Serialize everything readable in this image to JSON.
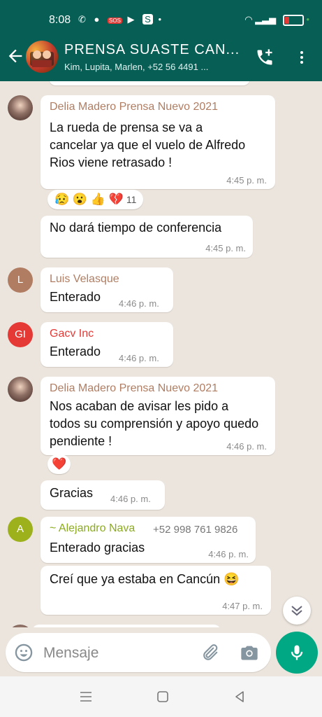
{
  "status_bar": {
    "time": "8:08",
    "icons": [
      "phone-icon",
      "chat-icon",
      "sos-icon",
      "youtube-icon",
      "s-app-icon"
    ],
    "right_icons": [
      "wifi-icon",
      "signal-icon",
      "battery-icon"
    ]
  },
  "header": {
    "title": "PRENSA SUASTE CAN...",
    "members": "Kim, Lupita, Marlen, +52 56 4491 ..."
  },
  "messages": [
    {
      "sender": "Delia Madero Prensa Nuevo 2021",
      "sender_color": "#b07d62",
      "text": "La rueda de prensa se va a cancelar ya que el vuelo de Alfredo Rios viene retrasado !",
      "time": "4:45 p. m.",
      "reactions": "😥 😮 👍 💔",
      "reaction_count": "11"
    },
    {
      "text": "No dará tiempo de conferencia",
      "time": "4:45 p. m."
    },
    {
      "sender": "Luis Velasque",
      "sender_color": "#b07d62",
      "avatar_letter": "L",
      "avatar_color": "#b07d62",
      "text": "Enterado",
      "time": "4:46 p. m."
    },
    {
      "sender": "Gacv Inc",
      "sender_color": "#e53935",
      "avatar_letter": "GI",
      "avatar_color": "#e53935",
      "text": "Enterado",
      "time": "4:46 p. m."
    },
    {
      "sender": "Delia Madero Prensa Nuevo 2021",
      "sender_color": "#b07d62",
      "text": "Nos acaban de avisar les pido a todos su comprensión y apoyo quedo pendiente !",
      "time": "4:46 p. m.",
      "reactions": "❤️"
    },
    {
      "text": "Gracias",
      "time": "4:46 p. m."
    },
    {
      "sender": "~ Alejandro Nava",
      "sender_color": "#8bab1f",
      "phone": "+52 998 761 9826",
      "avatar_letter": "A",
      "avatar_color": "#9cb11c",
      "text": "Enterado gracias",
      "time": "4:46 p. m."
    },
    {
      "text": "Creí que ya estaba en Cancún 😆",
      "time": "4:47 p. m."
    }
  ],
  "input": {
    "placeholder": "Mensaje"
  },
  "colors": {
    "header": "#075e54",
    "chat_bg": "#ece5dd",
    "mic_button": "#00a884"
  }
}
